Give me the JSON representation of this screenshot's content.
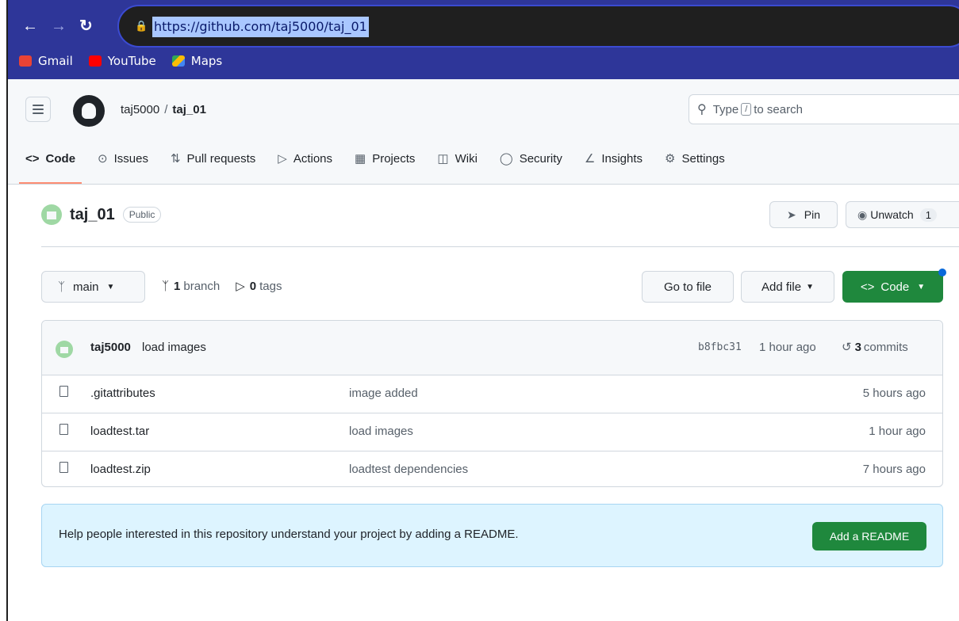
{
  "browser": {
    "back_icon": "arrow-left-icon",
    "forward_icon": "arrow-right-icon",
    "reload_icon": "reload-icon",
    "url": "https://github.com/taj5000/taj_01",
    "bookmarks": [
      {
        "label": "Gmail",
        "color": "#ea4335"
      },
      {
        "label": "YouTube",
        "color": "#ff0000"
      },
      {
        "label": "Maps",
        "color": "#34a853"
      }
    ]
  },
  "header": {
    "owner": "taj5000",
    "separator": "/",
    "repo": "taj_01",
    "search_prefix": "Type",
    "search_key": "/",
    "search_suffix": "to search"
  },
  "tabs": [
    {
      "label": "Code",
      "icon": "<>"
    },
    {
      "label": "Issues",
      "icon": "⊙"
    },
    {
      "label": "Pull requests",
      "icon": "⇅"
    },
    {
      "label": "Actions",
      "icon": "▷"
    },
    {
      "label": "Projects",
      "icon": "▦"
    },
    {
      "label": "Wiki",
      "icon": "◫"
    },
    {
      "label": "Security",
      "icon": "◯"
    },
    {
      "label": "Insights",
      "icon": "∠"
    },
    {
      "label": "Settings",
      "icon": "⚙"
    }
  ],
  "repo": {
    "name": "taj_01",
    "visibility": "Public",
    "pin_label": "Pin",
    "unwatch_label": "Unwatch",
    "watch_count": "1"
  },
  "toolbar": {
    "branch": "main",
    "branch_count": "1",
    "branch_word": "branch",
    "tag_count": "0",
    "tag_word": "tags",
    "goto_label": "Go to file",
    "add_label": "Add file",
    "code_label": "Code"
  },
  "latest_commit": {
    "author": "taj5000",
    "message": "load images",
    "sha": "b8fbc31",
    "when": "1 hour ago",
    "commit_count": "3",
    "commit_word": "commits"
  },
  "files": [
    {
      "name": ".gitattributes",
      "message": "image added",
      "age": "5 hours ago"
    },
    {
      "name": "loadtest.tar",
      "message": "load images",
      "age": "1 hour ago"
    },
    {
      "name": "loadtest.zip",
      "message": "loadtest dependencies",
      "age": "7 hours ago"
    }
  ],
  "readme_banner": {
    "text": "Help people interested in this repository understand your project by adding a README.",
    "button": "Add a README"
  },
  "colors": {
    "primary_button": "#1f883d",
    "tab_underline": "#fd8c73",
    "browser_chrome": "#2e3699"
  }
}
